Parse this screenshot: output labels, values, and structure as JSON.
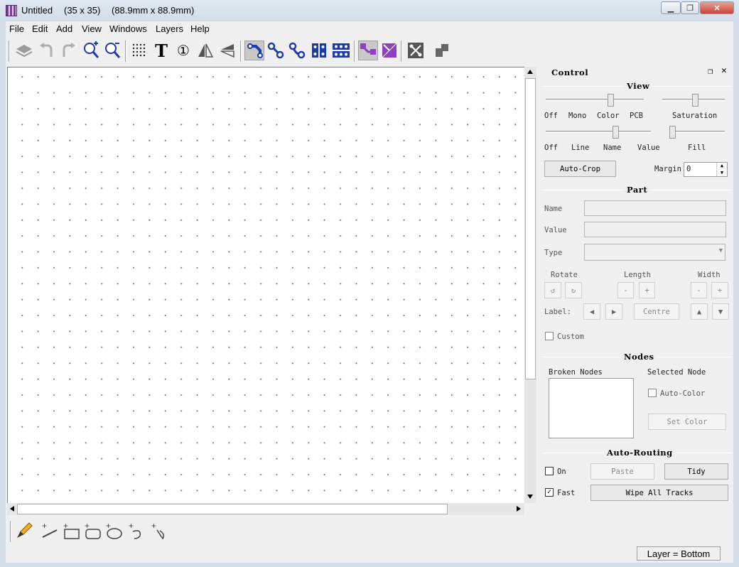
{
  "window": {
    "title": "Untitled",
    "grid_size": "(35 x 35)",
    "board_size": "(88.9mm x 88.9mm)"
  },
  "menubar": [
    "File",
    "Edit",
    "Add",
    "View",
    "Windows",
    "Layers",
    "Help"
  ],
  "control": {
    "title": "Control",
    "view": {
      "title": "View",
      "slider1_labels": [
        "Off",
        "Mono",
        "Color",
        "PCB"
      ],
      "saturation": "Saturation",
      "slider2_labels": [
        "Off",
        "Line",
        "Name",
        "Value"
      ],
      "fill": "Fill",
      "autocrop": "Auto-Crop",
      "margin_label": "Margin",
      "margin_value": "0"
    },
    "part": {
      "title": "Part",
      "name": "Name",
      "value": "Value",
      "type": "Type",
      "rotate": "Rotate",
      "length": "Length",
      "width": "Width",
      "minus": "-",
      "plus": "+",
      "label": "Label:",
      "centre": "Centre",
      "custom": "Custom"
    },
    "nodes": {
      "title": "Nodes",
      "broken": "Broken Nodes",
      "selected": "Selected Node",
      "autocolor": "Auto-Color",
      "setcolor": "Set Color"
    },
    "autorouting": {
      "title": "Auto-Routing",
      "on": "On",
      "paste": "Paste",
      "tidy": "Tidy",
      "fast": "Fast",
      "fast_checked": true,
      "wipe": "Wipe All Tracks"
    }
  },
  "status": {
    "layer": "Layer = Bottom"
  },
  "colors": {
    "accent": "#7a3aa8",
    "purple": "#8e3fc2",
    "blue": "#1e3ca8"
  }
}
